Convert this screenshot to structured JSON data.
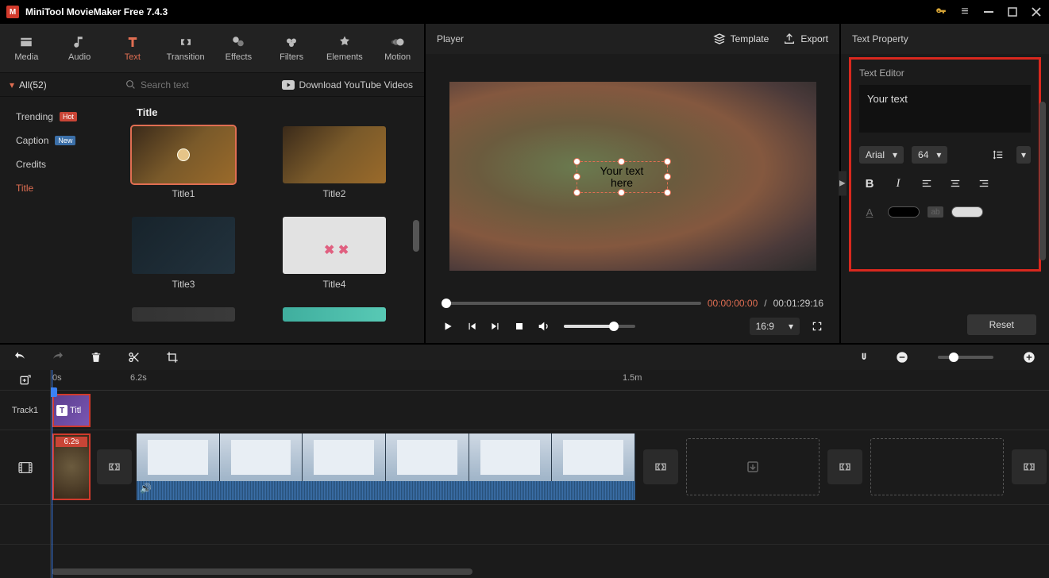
{
  "app": {
    "title": "MiniTool MovieMaker Free 7.4.3"
  },
  "modeTabs": {
    "media": "Media",
    "audio": "Audio",
    "text": "Text",
    "transition": "Transition",
    "effects": "Effects",
    "filters": "Filters",
    "elements": "Elements",
    "motion": "Motion"
  },
  "substrip": {
    "allLabel": "All(52)",
    "searchPlaceholder": "Search text",
    "downloadYT": "Download YouTube Videos"
  },
  "categories": {
    "trending": "Trending",
    "caption": "Caption",
    "credits": "Credits",
    "title": "Title",
    "badgeHot": "Hot",
    "badgeNew": "New"
  },
  "grid": {
    "heading": "Title",
    "t1": "Title1",
    "t2": "Title2",
    "t3": "Title3",
    "t4": "Title4"
  },
  "player": {
    "title": "Player",
    "template": "Template",
    "export": "Export",
    "previewText": "Your text\nhere",
    "curTime": "00:00:00:00",
    "totTime": "00:01:29:16",
    "aspect": "16:9"
  },
  "prop": {
    "panelTitle": "Text Property",
    "editorTitle": "Text Editor",
    "textValue": "Your text",
    "font": "Arial",
    "size": "64",
    "reset": "Reset"
  },
  "timeline": {
    "addLabel": "",
    "t0": "0s",
    "t1": "6.2s",
    "t2": "1.5m",
    "track1": "Track1",
    "titleClip": "Titl",
    "vidDur": "6.2s"
  }
}
